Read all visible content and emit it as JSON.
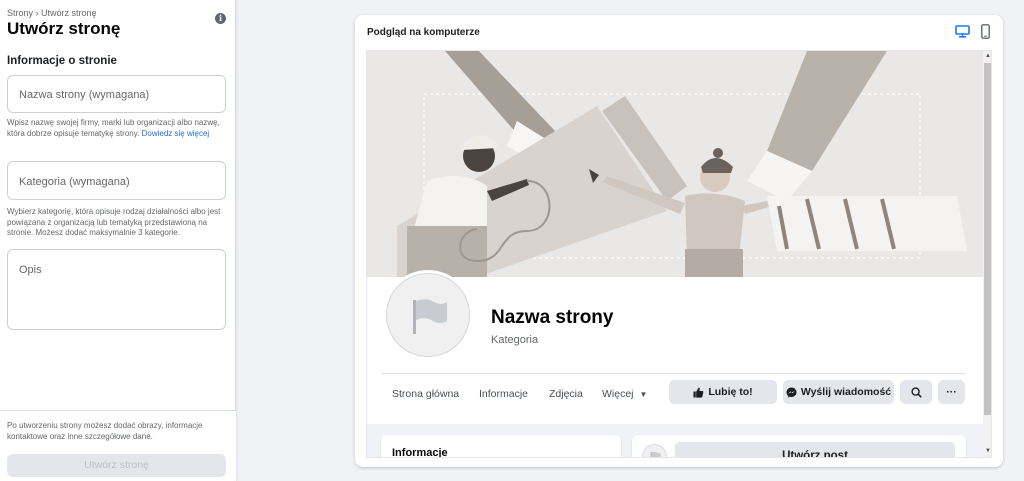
{
  "sidebar": {
    "breadcrumb": "Strony › Utwórz stronę",
    "title": "Utwórz stronę",
    "info_icon": "i",
    "section_heading": "Informacje o stronie",
    "name_field": {
      "placeholder": "Nazwa strony (wymagana)",
      "help": "Wpisz nazwę swojej firmy, marki lub organizacji albo nazwę, która dobrze opisuje tematykę strony.",
      "help_link": "Dowiedz się więcej"
    },
    "category_field": {
      "placeholder": "Kategoria (wymagana)",
      "help": "Wybierz kategorię, która opisuje rodzaj działalności albo jest powiązana z organizacją lub tematyką przedstawioną na stronie. Możesz dodać maksymalnie 3 kategorie."
    },
    "description_field": {
      "placeholder": "Opis"
    },
    "footer_text": "Po utworzeniu strony możesz dodać obrazy, informacje kontaktowe oraz inne szczegółowe dane.",
    "create_button": "Utwórz stronę"
  },
  "preview": {
    "title": "Podgląd na komputerze",
    "devices": [
      "desktop-icon",
      "mobile-icon"
    ],
    "page_name": "Nazwa strony",
    "page_category": "Kategoria",
    "tabs": [
      "Strona główna",
      "Informacje",
      "Zdjęcia",
      "Więcej"
    ],
    "like_button": "Lubię to!",
    "message_button": "Wyślij wiadomość",
    "more_button": "···",
    "info_card_title": "Informacje",
    "create_post": "Utwórz post"
  },
  "colors": {
    "link": "#216fdb",
    "accent_icon": "#1877f2",
    "button_bg": "#e4e6eb",
    "disabled_text": "#bcc0c4"
  }
}
